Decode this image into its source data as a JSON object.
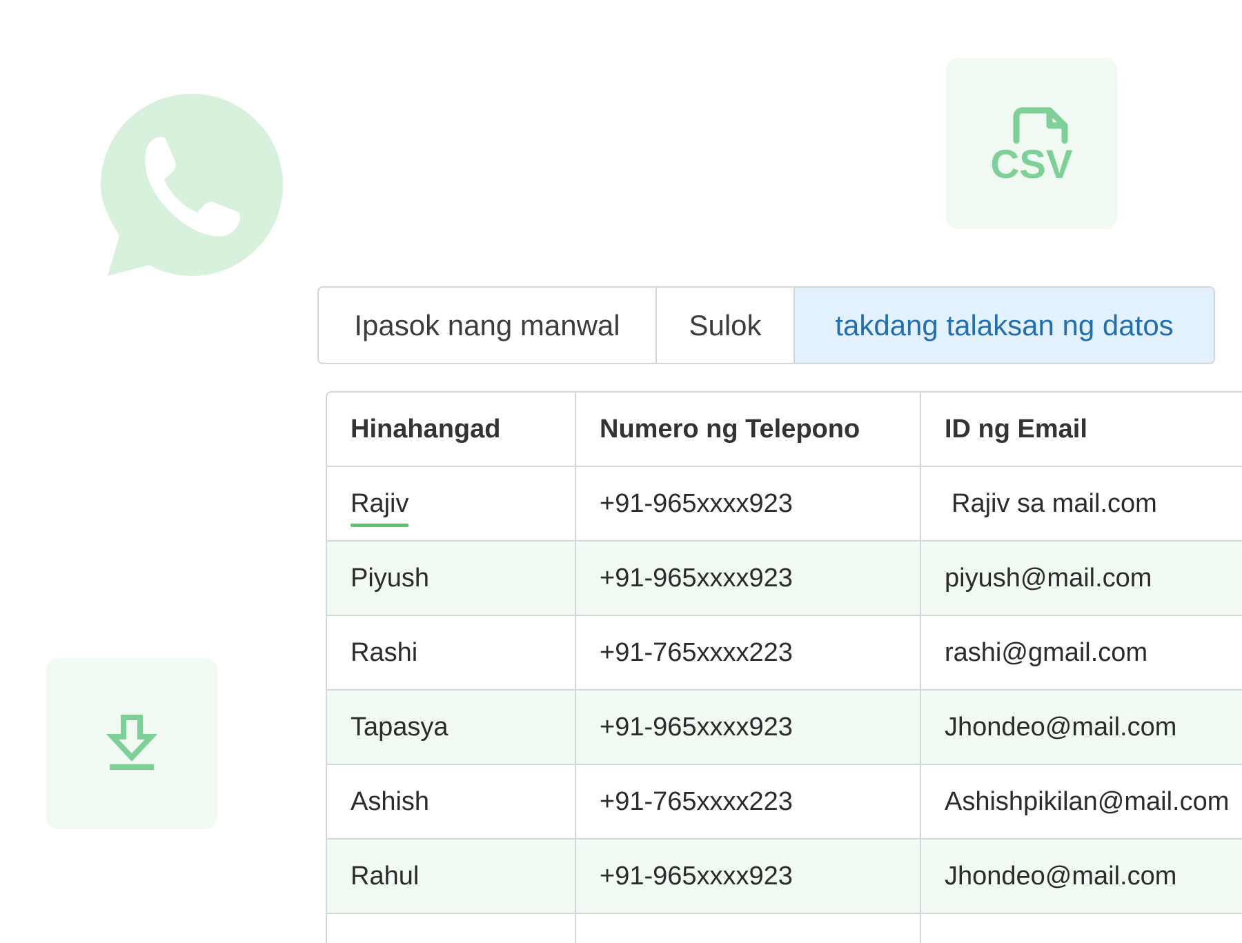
{
  "colors": {
    "accent_green": "#5cc46d",
    "icon_green": "#7fcf98",
    "tile_background": "#f1faf2",
    "active_tab_background": "#e3f0fd",
    "active_tab_text": "#1f6fb2",
    "alt_row_background": "#f2fbf3"
  },
  "icons": {
    "whatsapp": "whatsapp-icon",
    "csv_file": "csv-file-icon",
    "download": "download-icon"
  },
  "csv_tile": {
    "label": "CSV"
  },
  "tabs": [
    {
      "label": "Ipasok nang manwal",
      "active": false
    },
    {
      "label": "Sulok",
      "active": false
    },
    {
      "label": "takdang talaksan ng datos",
      "active": true
    }
  ],
  "table": {
    "columns": [
      "Hinahangad",
      "Numero ng Telepono",
      "ID ng Email"
    ],
    "rows": [
      {
        "name": "Rajiv",
        "phone": "+91-965xxxx923",
        "email": "Rajiv sa mail.com"
      },
      {
        "name": "Piyush",
        "phone": "+91-965xxxx923",
        "email": "piyush@mail.com"
      },
      {
        "name": "Rashi",
        "phone": "+91-765xxxx223",
        "email": "rashi@gmail.com"
      },
      {
        "name": "Tapasya",
        "phone": "+91-965xxxx923",
        "email": "Jhondeo@mail.com"
      },
      {
        "name": "Ashish",
        "phone": "+91-765xxxx223",
        "email": "Ashishpikilan@mail.com"
      },
      {
        "name": "Rahul",
        "phone": "+91-965xxxx923",
        "email": "Jhondeo@mail.com"
      },
      {
        "name": "",
        "phone": "",
        "email": ""
      }
    ]
  }
}
